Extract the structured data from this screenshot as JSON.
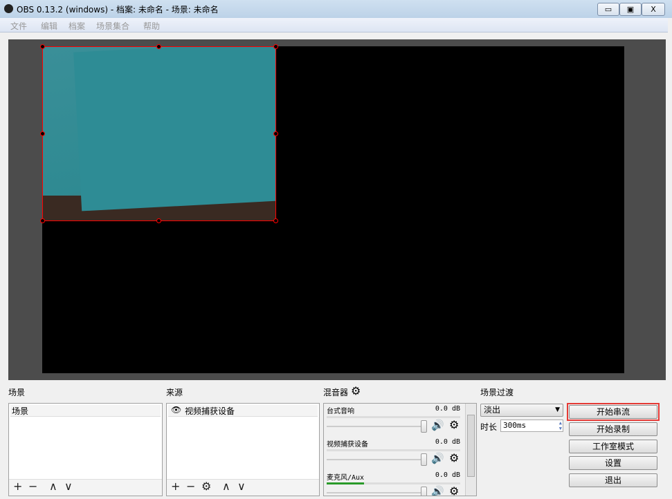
{
  "window": {
    "title": "OBS 0.13.2 (windows) - 档案: 未命名 - 场景: 未命名",
    "minimize": "▭",
    "maximize": "▣",
    "close": "X"
  },
  "menu": [
    "文件",
    "编辑",
    "档案",
    "场景集合",
    "帮助"
  ],
  "panels": {
    "scenes": {
      "label": "场景",
      "items": [
        "场景"
      ]
    },
    "sources": {
      "label": "来源",
      "items": [
        "视频捕获设备"
      ]
    },
    "mixer": {
      "label": "混音器",
      "channels": [
        {
          "name": "台式音响",
          "level": "0.0 dB",
          "meter": 0
        },
        {
          "name": "视频捕获设备",
          "level": "0.0 dB",
          "meter": 0
        },
        {
          "name": "麦克风/Aux",
          "level": "0.0 dB",
          "meter": 0.28
        }
      ]
    },
    "transition": {
      "label": "场景过渡",
      "selected": "淡出",
      "duration_label": "时长",
      "duration": "300ms"
    }
  },
  "controls": {
    "start_stream": "开始串流",
    "start_record": "开始录制",
    "studio_mode": "工作室模式",
    "settings": "设置",
    "exit": "退出"
  },
  "colors": {
    "highlight": "#e53935",
    "selection": "#ff0000"
  }
}
